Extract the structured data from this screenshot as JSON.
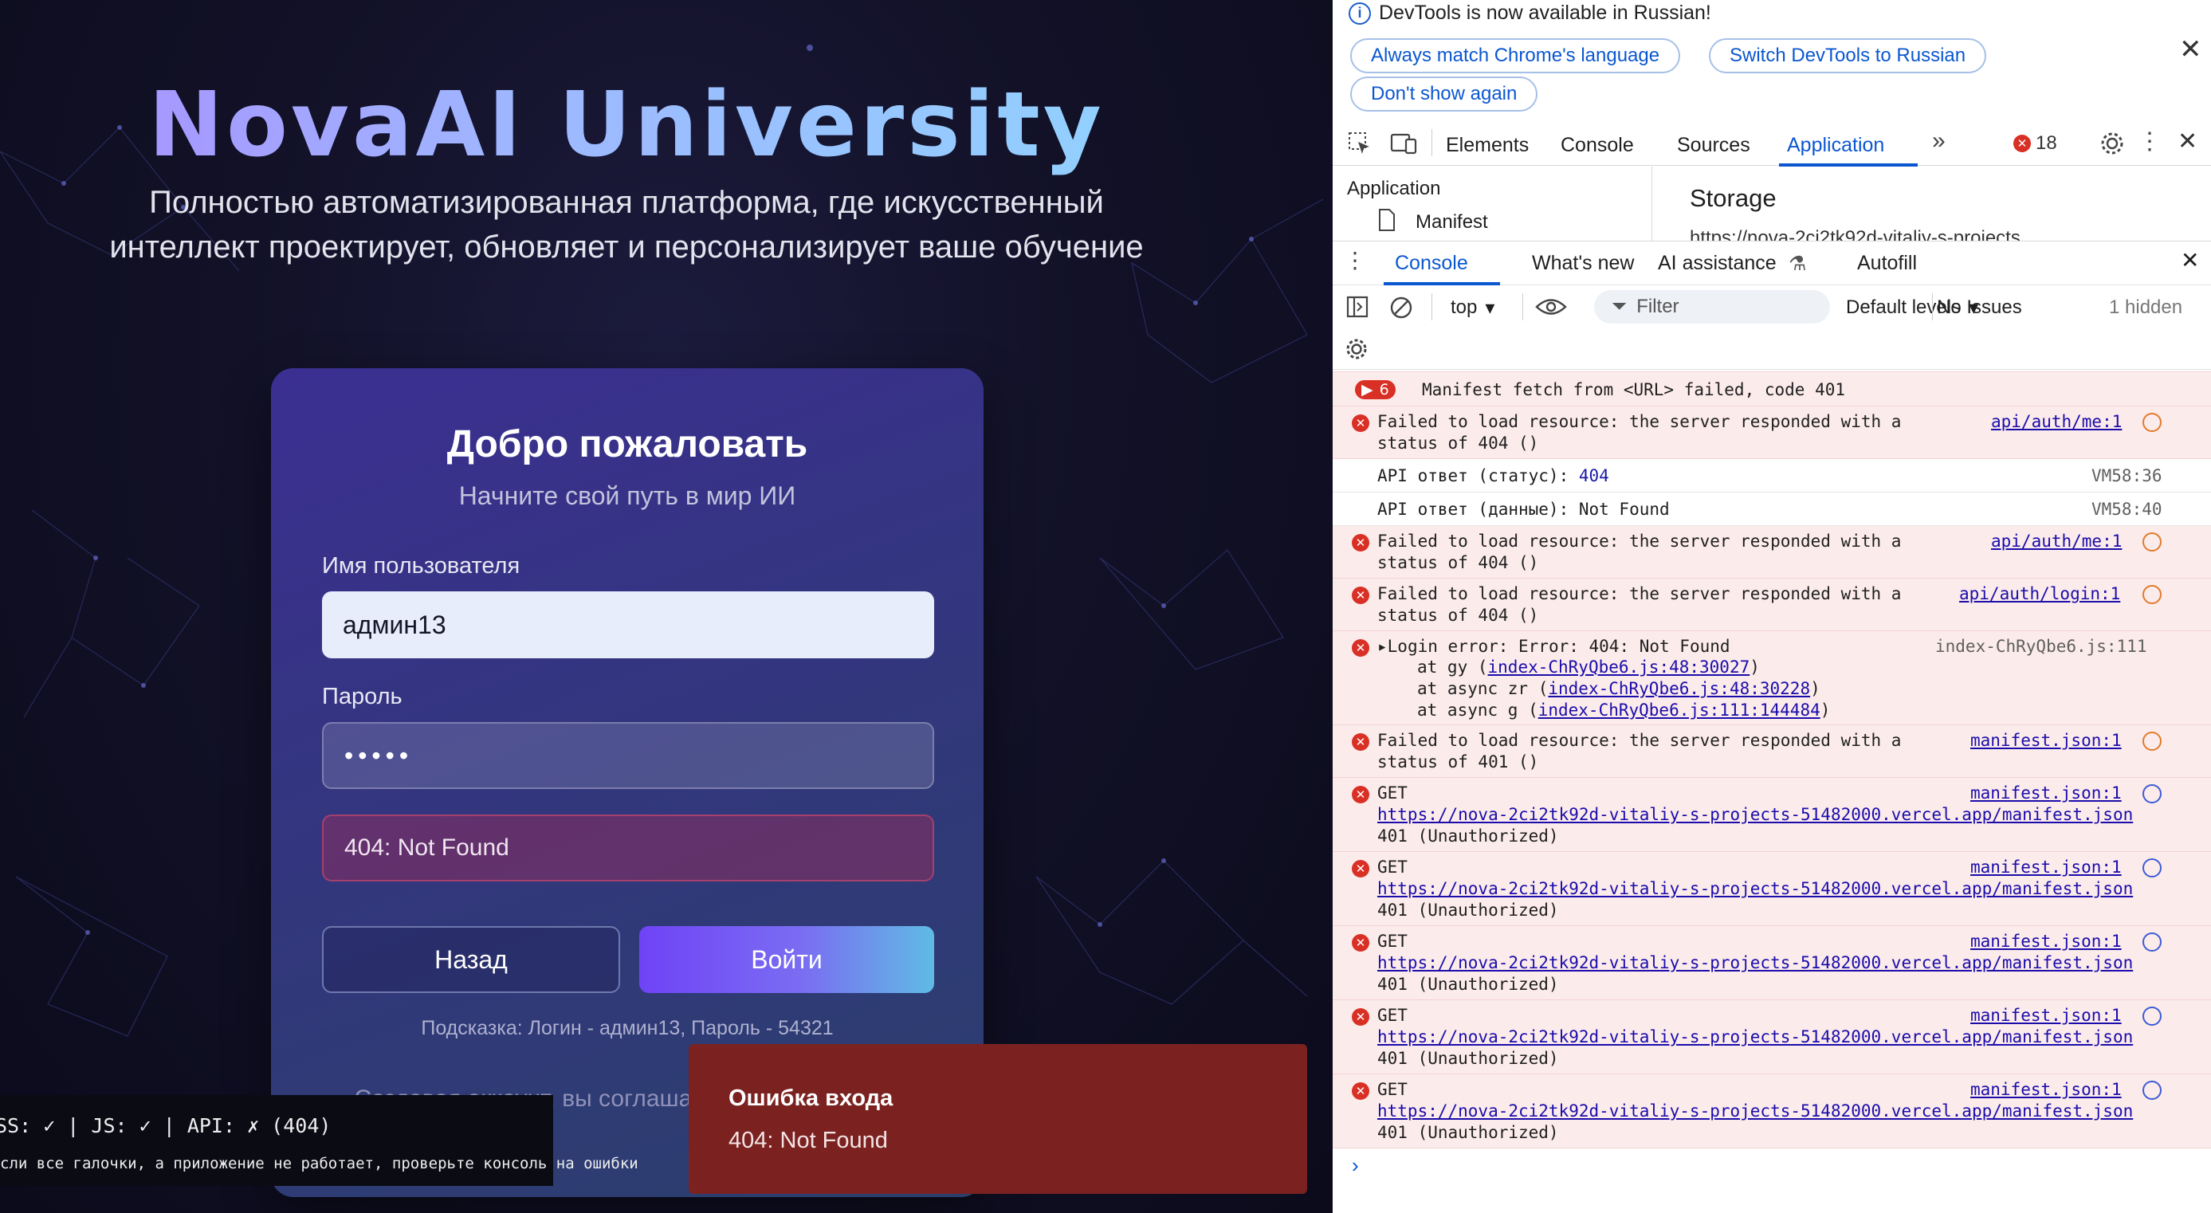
{
  "app": {
    "brand": "NovaAI University",
    "subtitle": "Полностью автоматизированная платформа, где искусственный интеллект проектирует, обновляет и персонализирует ваше обучение",
    "card": {
      "title": "Добро пожаловать",
      "tagline": "Начните свой путь в мир ИИ",
      "username_label": "Имя пользователя",
      "username_value": "админ13",
      "password_label": "Пароль",
      "password_mask": "•••••",
      "error_text": "404: Not Found",
      "back_button": "Назад",
      "login_button": "Войти",
      "hint": "Подсказка: Логин - админ13, Пароль - 54321",
      "terms_partial": "Создавая аккаунт, вы соглаша… использовани…"
    },
    "debug": {
      "line1": "SS: ✓ | JS: ✓ | API: ✗ (404)",
      "line2": "сли все галочки, а приложение не работает, проверьте консоль на ошибки"
    },
    "toast": {
      "title": "Ошибка входа",
      "message": "404: Not Found"
    }
  },
  "devtools": {
    "notice": {
      "message": "DevTools is now available in Russian!",
      "btn_match": "Always match Chrome's language",
      "btn_switch": "Switch DevTools to Russian",
      "btn_dont_show": "Don't show again"
    },
    "tabs": [
      "Elements",
      "Console",
      "Sources",
      "Application"
    ],
    "active_tab": "Application",
    "error_count": "18",
    "application": {
      "section": "Application",
      "item": "Manifest",
      "storage_title": "Storage",
      "storage_url": "https://nova-2ci2tk92d-vitaliy-s-projects"
    },
    "drawer_tabs": [
      "Console",
      "What's new",
      "AI assistance",
      "Autofill"
    ],
    "toolbar": {
      "context": "top",
      "filter_placeholder": "Filter",
      "levels": "Default levels",
      "issues": "No Issues",
      "hidden": "1 hidden"
    },
    "messages": [
      {
        "group_count": "6",
        "text": "Manifest fetch from <URL> failed, code 401"
      },
      {
        "text": "Failed to load resource: the server responded with a\nstatus of 404 ()",
        "source": "api/auth/me:1"
      },
      {
        "text": "API ответ (статус): ",
        "value": "404",
        "source": "VM58:36"
      },
      {
        "text": "API ответ (данные): Not Found",
        "source": "VM58:40"
      },
      {
        "text": "Failed to load resource: the server responded with a\nstatus of 404 ()",
        "source": "api/auth/me:1"
      },
      {
        "text": "Failed to load resource: the server responded with a\nstatus of 404 ()",
        "source": "api/auth/login:1"
      },
      {
        "text": "Login error: Error: 404: Not Found",
        "source": "index-ChRyQbe6.js:111",
        "stack": [
          {
            "prefix": "at gy (",
            "link": "index-ChRyQbe6.js:48:30027",
            "suffix": ")"
          },
          {
            "prefix": "at async zr (",
            "link": "index-ChRyQbe6.js:48:30228",
            "suffix": ")"
          },
          {
            "prefix": "at async g (",
            "link": "index-ChRyQbe6.js:111:144484",
            "suffix": ")"
          }
        ]
      },
      {
        "text": "Failed to load resource: the server responded with a\nstatus of 401 ()",
        "source": "manifest.json:1"
      },
      {
        "method": "GET",
        "url": "https://nova-2ci2tk92d-vitaliy-s-projects-51482000.vercel.app/manifest.json",
        "status": "401 (Unauthorized)",
        "source": "manifest.json:1"
      },
      {
        "method": "GET",
        "url": "https://nova-2ci2tk92d-vitaliy-s-projects-51482000.vercel.app/manifest.json",
        "status": "401 (Unauthorized)",
        "source": "manifest.json:1"
      },
      {
        "method": "GET",
        "url": "https://nova-2ci2tk92d-vitaliy-s-projects-51482000.vercel.app/manifest.json",
        "status": "401 (Unauthorized)",
        "source": "manifest.json:1"
      },
      {
        "method": "GET",
        "url": "https://nova-2ci2tk92d-vitaliy-s-projects-51482000.vercel.app/manifest.json",
        "status": "401 (Unauthorized)",
        "source": "manifest.json:1"
      },
      {
        "method": "GET",
        "url": "https://nova-2ci2tk92d-vitaliy-s-projects-51482000.vercel.app/manifest.json",
        "status": "401 (Unauthorized)",
        "source": "manifest.json:1"
      }
    ],
    "colors": {
      "accent": "#0b57d0",
      "error_bg": "#fcebeb",
      "error_icon": "#d93025"
    }
  }
}
